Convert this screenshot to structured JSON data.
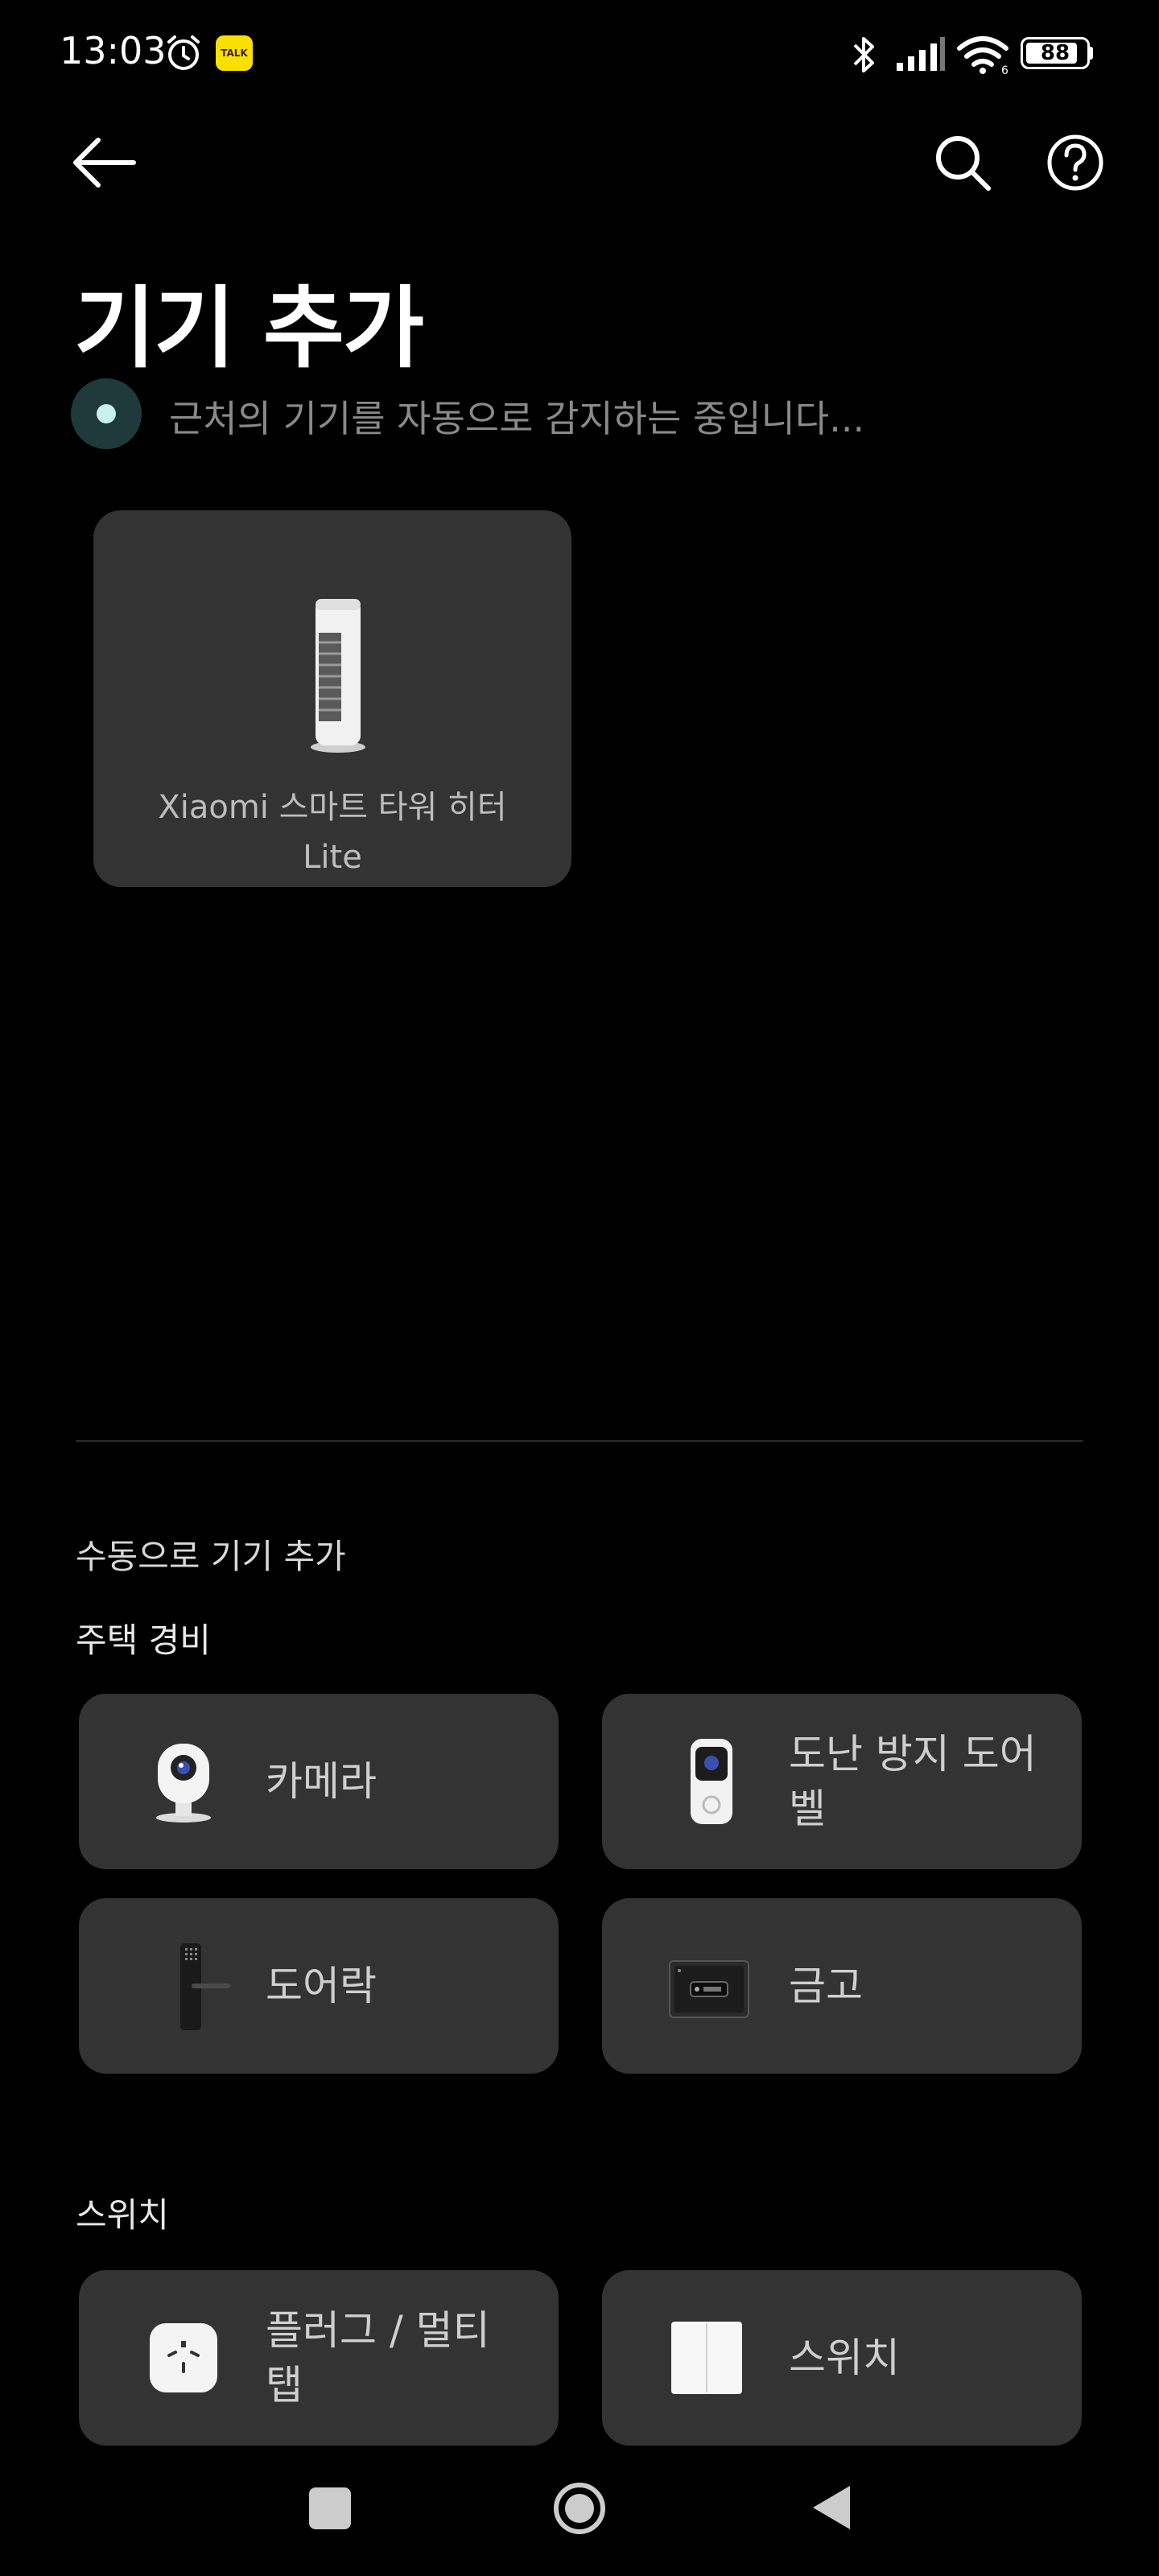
{
  "status_bar": {
    "time": "13:03",
    "kakao_badge": "TALK",
    "battery_level": "88",
    "wifi_label": "6",
    "icons": [
      "alarm-icon",
      "kakaotalk-icon",
      "bluetooth-icon",
      "signal-icon",
      "wifi-icon",
      "battery-icon"
    ]
  },
  "header": {
    "title": "기기 추가",
    "scan_status": "근처의 기기를 자동으로 감지하는 중입니다...",
    "icons": [
      "back-arrow-icon",
      "search-icon",
      "help-icon"
    ]
  },
  "nearby_devices": [
    {
      "label": "Xiaomi 스마트 타워 히터 Lite",
      "icon": "tower-heater-icon"
    }
  ],
  "manual": {
    "title": "수동으로 기기 추가",
    "sections": [
      {
        "title": "주택 경비",
        "items": [
          {
            "label": "카메라",
            "icon": "camera-icon"
          },
          {
            "label": "도난 방지 도어벨",
            "icon": "doorbell-icon"
          },
          {
            "label": "도어락",
            "icon": "door-lock-icon"
          },
          {
            "label": "금고",
            "icon": "safe-icon"
          }
        ]
      },
      {
        "title": "스위치",
        "items": [
          {
            "label": "플러그 / 멀티탭",
            "icon": "power-plug-icon"
          },
          {
            "label": "스위치",
            "icon": "wall-switch-icon"
          }
        ]
      }
    ]
  },
  "nav_bar": {
    "icons": [
      "recents-square-icon",
      "home-circle-icon",
      "back-triangle-icon"
    ]
  },
  "colors": {
    "background": "#000000",
    "card": "#333333",
    "accent_dot": "#c7f0ee"
  }
}
